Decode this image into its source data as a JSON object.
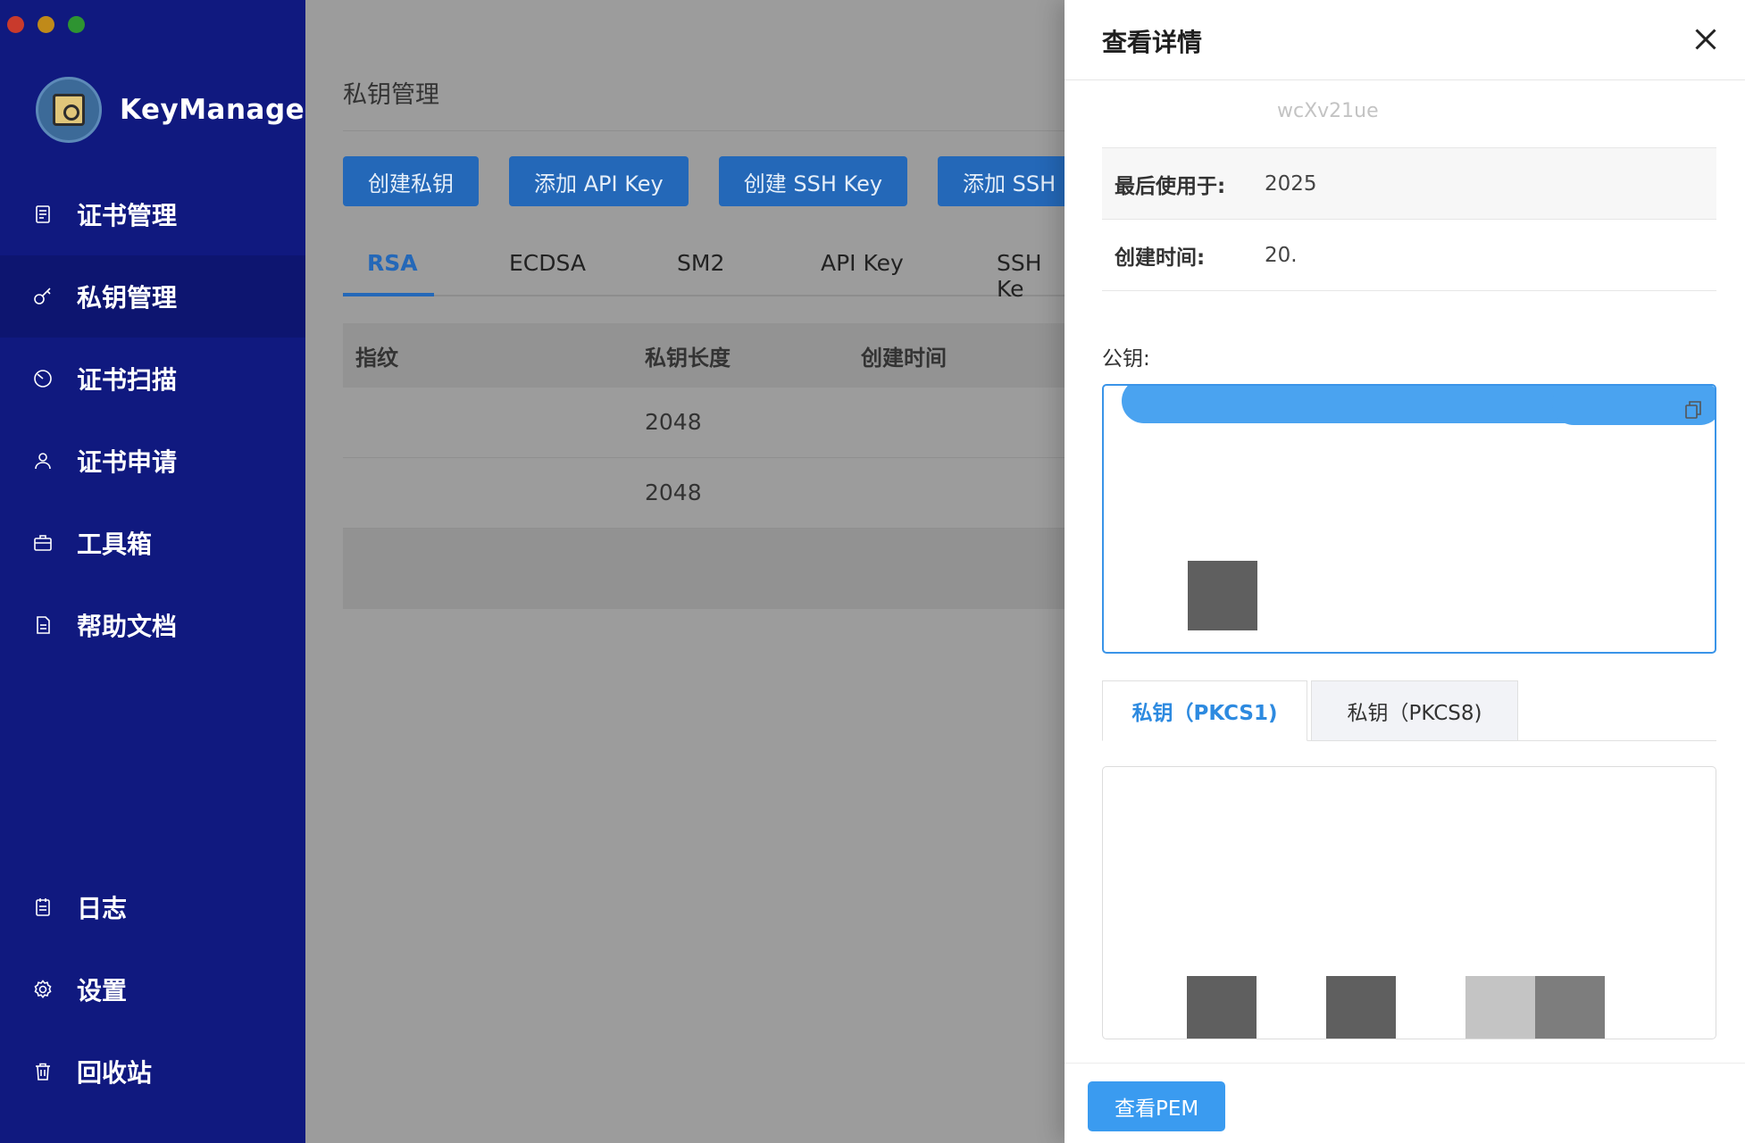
{
  "window": {
    "controls": [
      "close",
      "minimize",
      "maximize"
    ]
  },
  "sidebar": {
    "app_name": "KeyManager",
    "items": [
      {
        "label": "证书管理",
        "icon": "certificate-icon"
      },
      {
        "label": "私钥管理",
        "icon": "key-icon",
        "active": true
      },
      {
        "label": "证书扫描",
        "icon": "scan-icon"
      },
      {
        "label": "证书申请",
        "icon": "user-icon"
      },
      {
        "label": "工具箱",
        "icon": "toolbox-icon"
      },
      {
        "label": "帮助文档",
        "icon": "document-icon"
      }
    ],
    "bottom_items": [
      {
        "label": "日志",
        "icon": "log-icon"
      },
      {
        "label": "设置",
        "icon": "gear-icon"
      },
      {
        "label": "回收站",
        "icon": "trash-icon"
      }
    ]
  },
  "main": {
    "title": "私钥管理",
    "buttons": [
      "创建私钥",
      "添加 API Key",
      "创建 SSH Key",
      "添加 SSH K"
    ],
    "tabs": [
      "RSA",
      "ECDSA",
      "SM2",
      "API Key",
      "SSH Ke"
    ],
    "active_tab": "RSA",
    "table": {
      "headers": [
        "指纹",
        "私钥长度",
        "创建时间"
      ],
      "rows": [
        {
          "key_length": "2048"
        },
        {
          "key_length": "2048"
        }
      ]
    }
  },
  "drawer": {
    "title": "查看详情",
    "partial_value": "wcXv21ue",
    "details": [
      {
        "label": "最后使用于:",
        "value": "2025"
      },
      {
        "label": "创建时间:",
        "value": "20."
      }
    ],
    "public_key_label": "公钥:",
    "key_tabs": [
      "私钥（PKCS1)",
      "私钥（PKCS8)"
    ],
    "active_key_tab": "私钥（PKCS1)",
    "footer_button": "查看PEM"
  },
  "colors": {
    "sidebar": "#10197f",
    "primary": "#2d8ae0",
    "overlay": "#9c9c9c"
  }
}
